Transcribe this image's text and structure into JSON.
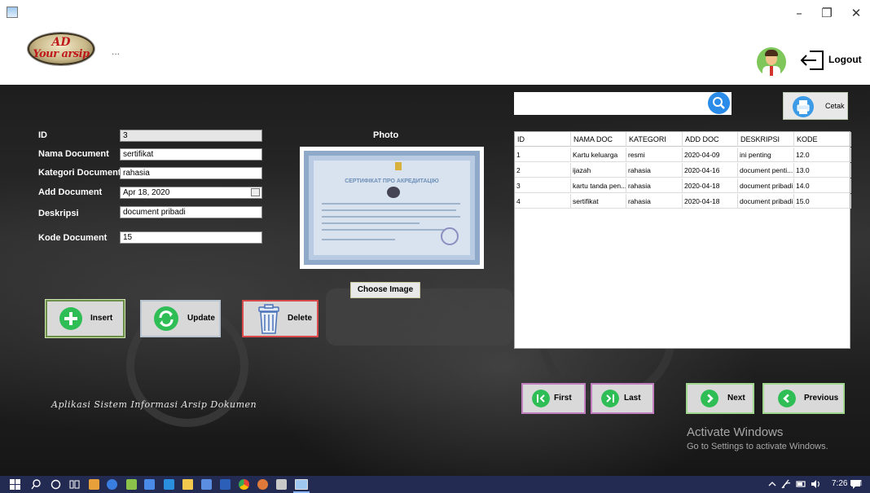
{
  "window": {
    "minimize": "–",
    "maximize": "❐",
    "close": "✕"
  },
  "header": {
    "logo_line1": "AD",
    "logo_line2": "Your arsip",
    "dots": "...",
    "logout_label": "Logout"
  },
  "form": {
    "labels": {
      "id": "ID",
      "nama": "Nama Document",
      "kategori": "Kategori Document",
      "add": "Add Document",
      "deskripsi": "Deskripsi",
      "kode": "Kode Document"
    },
    "values": {
      "id": "3",
      "nama": "sertifikat",
      "kategori": "rahasia",
      "add": "Apr 18, 2020",
      "deskripsi": "document pribadi",
      "kode": "15"
    }
  },
  "photo": {
    "label": "Photo",
    "cert_title": "СЕРТИФІКАТ ПРО АКРЕДИТАЦІЮ",
    "choose_label": "Choose Image"
  },
  "actions": {
    "insert": "Insert",
    "update": "Update",
    "delete": "Delete"
  },
  "tagline": "Aplikasi Sistem Informasi Arsip Dokumen",
  "search": {
    "value": "",
    "cetak_label": "Cetak"
  },
  "table": {
    "columns": [
      "ID",
      "NAMA DOC",
      "KATEGORI",
      "ADD DOC",
      "DESKRIPSI",
      "KODE"
    ],
    "rows": [
      [
        "1",
        "Kartu keluarga",
        "resmi",
        "2020-04-09",
        "ini penting",
        "12.0"
      ],
      [
        "2",
        "ijazah",
        "rahasia",
        "2020-04-16",
        "document penti...",
        "13.0"
      ],
      [
        "3",
        "kartu tanda pen...",
        "rahasia",
        "2020-04-18",
        "document pribadi",
        "14.0"
      ],
      [
        "4",
        "sertifikat",
        "rahasia",
        "2020-04-18",
        "document pribadi",
        "15.0"
      ]
    ]
  },
  "nav": {
    "first": "First",
    "last": "Last",
    "next": "Next",
    "previous": "Previous"
  },
  "activation": {
    "title": "Activate Windows",
    "subtitle": "Go to Settings to activate Windows."
  },
  "taskbar": {
    "time": "7:26 PM"
  },
  "colors": {
    "accent_green": "#2fbd55",
    "search_blue": "#2a8ce8",
    "taskbar": "#242b52"
  }
}
